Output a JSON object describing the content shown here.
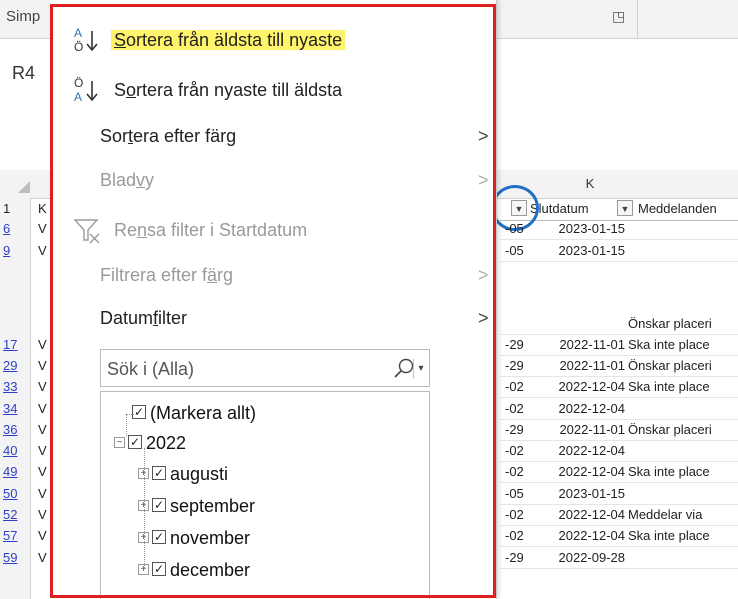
{
  "ribbon": {
    "label": "Simp",
    "launcher_icon": "dialog-launcher-icon"
  },
  "namebox": {
    "value": "R4"
  },
  "columns": {
    "k_letter": "K"
  },
  "header_row": {
    "row_num": "1",
    "col_a": "K",
    "slutdatum": "Slutdatum",
    "meddelanden": "Meddelanden"
  },
  "rows": [
    {
      "num": "6",
      "a": "V",
      "left": "-05",
      "date": "2023-01-15",
      "msg": ""
    },
    {
      "num": "9",
      "a": "V",
      "left": "-05",
      "date": "2023-01-15",
      "msg": ""
    },
    {
      "num": "",
      "a": "",
      "left": "",
      "date": "",
      "msg": "Önskar placeri"
    },
    {
      "num": "17",
      "a": "V",
      "left": "-29",
      "date": "2022-11-01",
      "msg": "Ska inte place"
    },
    {
      "num": "29",
      "a": "V",
      "left": "-29",
      "date": "2022-11-01",
      "msg": "Önskar placeri"
    },
    {
      "num": "33",
      "a": "V",
      "left": "-02",
      "date": "2022-12-04",
      "msg": "Ska inte place"
    },
    {
      "num": "34",
      "a": "V",
      "left": "-02",
      "date": "2022-12-04",
      "msg": ""
    },
    {
      "num": "36",
      "a": "V",
      "left": "-29",
      "date": "2022-11-01",
      "msg": "Önskar placeri"
    },
    {
      "num": "40",
      "a": "V",
      "left": "-02",
      "date": "2022-12-04",
      "msg": ""
    },
    {
      "num": "49",
      "a": "V",
      "left": "-02",
      "date": "2022-12-04",
      "msg": "Ska inte place"
    },
    {
      "num": "50",
      "a": "V",
      "left": "-05",
      "date": "2023-01-15",
      "msg": ""
    },
    {
      "num": "52",
      "a": "V",
      "left": "-02",
      "date": "2022-12-04",
      "msg": "Meddelar via"
    },
    {
      "num": "57",
      "a": "V",
      "left": "-02",
      "date": "2022-12-04",
      "msg": "Ska inte place"
    },
    {
      "num": "59",
      "a": "V",
      "left": "-29",
      "date": "2022-09-28",
      "msg": ""
    }
  ],
  "menu": {
    "sort_asc": {
      "pre": "",
      "ul": "S",
      "post": "ortera från äldsta till nyaste"
    },
    "sort_desc": {
      "pre": "S",
      "ul": "o",
      "post": "rtera från nyaste till äldsta"
    },
    "sort_color": {
      "pre": "Sor",
      "ul": "t",
      "post": "era efter färg"
    },
    "sheet_view": {
      "pre": "Blad",
      "ul": "v",
      "post": "y"
    },
    "clear_filter": {
      "pre": "Re",
      "ul": "n",
      "post": "sa filter i Startdatum"
    },
    "filter_color": {
      "pre": "Filtrera efter f",
      "ul": "ä",
      "post": "rg"
    },
    "date_filter": {
      "pre": "Datum",
      "ul": "f",
      "post": "ilter"
    },
    "chevron": ">",
    "search_placeholder": "Sök i (Alla)",
    "tree": [
      {
        "label": "(Markera allt)"
      },
      {
        "label": "2022"
      },
      {
        "label": "augusti"
      },
      {
        "label": "september"
      },
      {
        "label": "november"
      },
      {
        "label": "december"
      }
    ],
    "check": "✓",
    "minus": "−",
    "plus": "+"
  },
  "colors": {
    "highlight": "#fff46a",
    "frame": "#e02020",
    "circle": "#1f6fc8",
    "link_row": "#2f3fc9"
  }
}
